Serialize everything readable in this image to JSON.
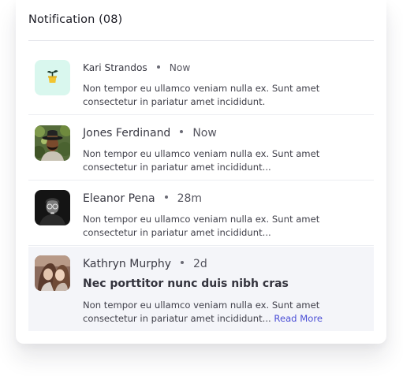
{
  "header": {
    "title": "Notification (08)"
  },
  "colors": {
    "accent_link": "#4b4fd6",
    "plant_tile": "#d9f7ee",
    "highlight_row": "#f4f5f9"
  },
  "notifications": [
    {
      "name": "Kari Strandos",
      "time": "Now",
      "avatar_icon": "plant-pot-icon",
      "line1": "Non tempor eu ullamco veniam nulla ex. Sunt amet",
      "line2": "consectetur in pariatur amet incididunt."
    },
    {
      "name": "Jones Ferdinand",
      "time": "Now",
      "avatar_icon": "person-photo",
      "line1": "Non tempor eu ullamco veniam nulla ex. Sunt amet",
      "line2": "consectetur in pariatur amet incididunt..."
    },
    {
      "name": "Eleanor Pena",
      "time": "28m",
      "avatar_icon": "person-photo",
      "line1": "Non tempor eu ullamco veniam nulla ex. Sunt amet",
      "line2": "consectetur in pariatur amet incididunt..."
    },
    {
      "name": "Kathryn Murphy",
      "time": "2d",
      "avatar_icon": "person-photo",
      "title": "Nec porttitor nunc duis nibh cras",
      "line1": "Non tempor eu ullamco veniam nulla ex. Sunt amet",
      "line2": "consectetur in pariatur amet incididunt...",
      "read_more": "Read More"
    }
  ]
}
